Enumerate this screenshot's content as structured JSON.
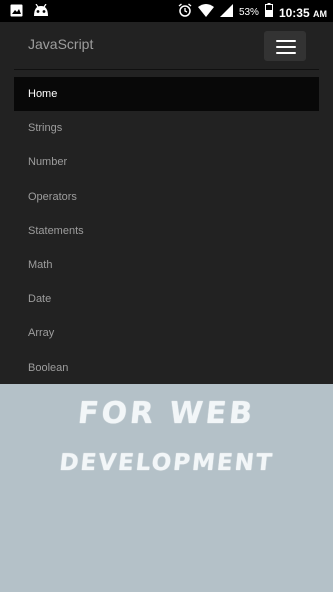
{
  "status_bar": {
    "icons_left": [
      "image-icon",
      "android-icon"
    ],
    "icons_right": [
      "alarm-icon",
      "wifi-icon",
      "signal-icon",
      "battery-icon"
    ],
    "battery": "53%",
    "time": "10:35",
    "ampm": "AM"
  },
  "navbar": {
    "brand": "JavaScript",
    "items": [
      {
        "label": "Home",
        "active": true
      },
      {
        "label": "Strings"
      },
      {
        "label": "Number"
      },
      {
        "label": "Operators"
      },
      {
        "label": "Statements"
      },
      {
        "label": "Math"
      },
      {
        "label": "Date"
      },
      {
        "label": "Array"
      },
      {
        "label": "Boolean"
      }
    ]
  },
  "banner": {
    "line1": "FOR WEB",
    "line2": "DEVELOPMENT"
  },
  "colors": {
    "navbar_bg": "#222222",
    "active_bg": "#080808",
    "banner_bg": "#b4c1c8"
  }
}
